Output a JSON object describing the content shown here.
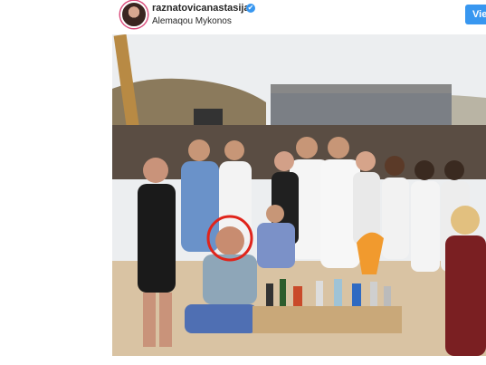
{
  "header": {
    "username": "raznatovicanastasija",
    "location": "Alemaqou Mykonos",
    "verified_glyph": "✔",
    "view_button": "Vie"
  },
  "photo": {
    "description_icon": "group-photo",
    "highlight_color": "#e0241b"
  },
  "colors": {
    "accent": "#3897f0",
    "text": "#262626"
  }
}
